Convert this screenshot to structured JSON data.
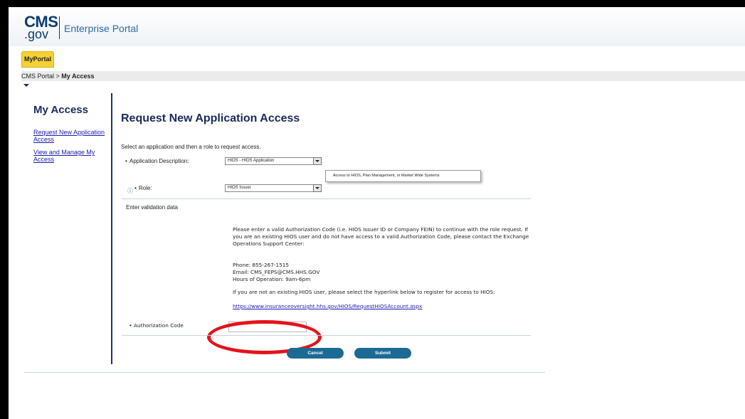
{
  "header": {
    "logo_cms": "CMS",
    "logo_gov": ".gov",
    "portal_title": "Enterprise Portal"
  },
  "tabs": {
    "myportal": "MyPortal"
  },
  "breadcrumb": {
    "root": "CMS Portal",
    "separator": " > ",
    "current": "My Access"
  },
  "sidebar": {
    "title": "My Access",
    "links": [
      "Request New Application Access",
      "View and Manage My Access"
    ]
  },
  "main": {
    "title": "Request New Application Access",
    "instruction": "Select an application and then a role to request access.",
    "app_label": "Application Description:",
    "app_value": "HIOS - HIOS Application",
    "role_label": "Role:",
    "role_value": "HIOS Issuer",
    "required_marker": "•",
    "tooltip": "Access to HIOS, Plan Management, or Market Wide Systems",
    "validation_heading": "Enter validation data",
    "paragraph1": "Please enter a valid Authorization Code (i.e. HIOS Issuer ID or Company FEIN) to continue with the role request. If you are an existing HIOS user and do not have access to a valid Authorization Code, please contact the Exchange Operations Support Center:",
    "phone": "Phone: 855-267-1515",
    "email": "Email: CMS_FEPS@CMS.HHS.GOV",
    "hours": "Hours of Operation: 9am-6pm",
    "register_note": "If you are not an existing HIOS user, please select the hyperlink below to register for access to HIOS:",
    "register_link": "https://www.insuranceoversight.hhs.gov/HIOS/RequestHIOSAccount.aspx",
    "auth_label": "Authorization Code",
    "auth_value": "",
    "cancel": "Cancel",
    "submit": "Submit"
  },
  "colors": {
    "annotation_circle": "#e4141b",
    "button": "#1b6a93",
    "tab": "#f5d033",
    "sidebar_rule": "#1f2a8a"
  },
  "icons": {
    "info": "info-icon",
    "dropdown": "chevron-down-icon",
    "breadcrumb_caret": "caret-down-icon"
  }
}
